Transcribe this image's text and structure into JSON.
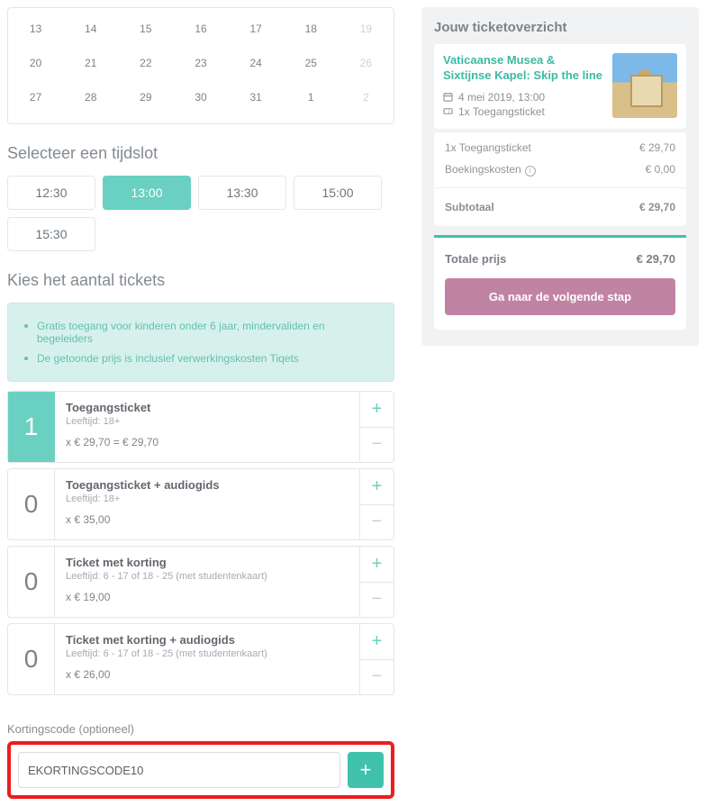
{
  "calendar": {
    "rows": [
      [
        {
          "d": "13"
        },
        {
          "d": "14"
        },
        {
          "d": "15"
        },
        {
          "d": "16"
        },
        {
          "d": "17"
        },
        {
          "d": "18"
        },
        {
          "d": "19",
          "disabled": true
        }
      ],
      [
        {
          "d": "20"
        },
        {
          "d": "21"
        },
        {
          "d": "22"
        },
        {
          "d": "23"
        },
        {
          "d": "24"
        },
        {
          "d": "25"
        },
        {
          "d": "26",
          "disabled": true
        }
      ],
      [
        {
          "d": "27"
        },
        {
          "d": "28"
        },
        {
          "d": "29"
        },
        {
          "d": "30"
        },
        {
          "d": "31"
        },
        {
          "d": "1"
        },
        {
          "d": "2",
          "disabled": true
        }
      ]
    ]
  },
  "sections": {
    "timeslot_title": "Selecteer een tijdslot",
    "tickets_title": "Kies het aantal tickets",
    "coupon_label": "Kortingscode (optioneel)"
  },
  "timeslots": [
    {
      "label": "12:30",
      "active": false
    },
    {
      "label": "13:00",
      "active": true
    },
    {
      "label": "13:30",
      "active": false
    },
    {
      "label": "15:00",
      "active": false
    },
    {
      "label": "15:30",
      "active": false
    }
  ],
  "info": {
    "line1": "Gratis toegang voor kinderen onder 6 jaar, mindervaliden en begeleiders",
    "line2": "De getoonde prijs is inclusief verwerkingskosten Tiqets"
  },
  "tickets": [
    {
      "qty": "1",
      "selected": true,
      "name": "Toegangsticket",
      "age": "Leeftijd: 18+",
      "price": "x € 29,70 = € 29,70"
    },
    {
      "qty": "0",
      "selected": false,
      "name": "Toegangsticket + audiogids",
      "age": "Leeftijd: 18+",
      "price": "x € 35,00"
    },
    {
      "qty": "0",
      "selected": false,
      "name": "Ticket met korting",
      "age": "Leeftijd: 6 - 17 of 18 - 25 (met studentenkaart)",
      "price": "x € 19,00"
    },
    {
      "qty": "0",
      "selected": false,
      "name": "Ticket met korting + audiogids",
      "age": "Leeftijd: 6 - 17 of 18 - 25 (met studentenkaart)",
      "price": "x € 26,00"
    }
  ],
  "coupon": {
    "value": "EKORTINGSCODE10"
  },
  "cart": {
    "title": "Jouw ticketoverzicht",
    "product_title": "Vaticaanse Musea & Sixtijnse Kapel: Skip the line",
    "date": "4 mei 2019, 13:00",
    "qty_line": "1x Toegangsticket",
    "items": [
      {
        "label": "1x Toegangsticket",
        "value": "€ 29,70"
      },
      {
        "label": "Boekingskosten",
        "value": "€ 0,00",
        "info": true
      }
    ],
    "subtotal_label": "Subtotaal",
    "subtotal_value": "€ 29,70",
    "total_label": "Totale prijs",
    "total_value": "€ 29,70",
    "next_label": "Ga naar de volgende stap"
  }
}
